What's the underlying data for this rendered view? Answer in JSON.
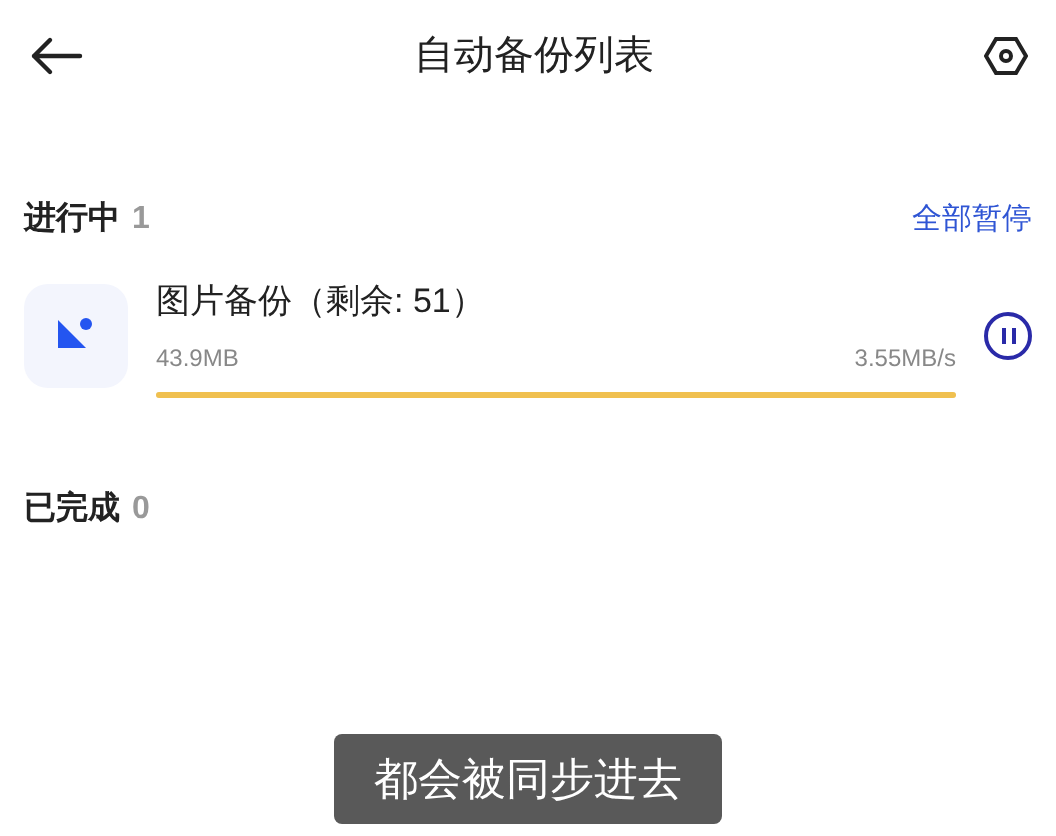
{
  "header": {
    "title": "自动备份列表"
  },
  "in_progress": {
    "label": "进行中",
    "count": "1",
    "action": "全部暂停",
    "items": [
      {
        "name": "图片备份（剩余: 51）",
        "size": "43.9MB",
        "speed": "3.55MB/s",
        "level": 1.0,
        "paused": false
      }
    ]
  },
  "completed": {
    "label": "已完成",
    "count": "0"
  },
  "caption": "都会被同步进去"
}
